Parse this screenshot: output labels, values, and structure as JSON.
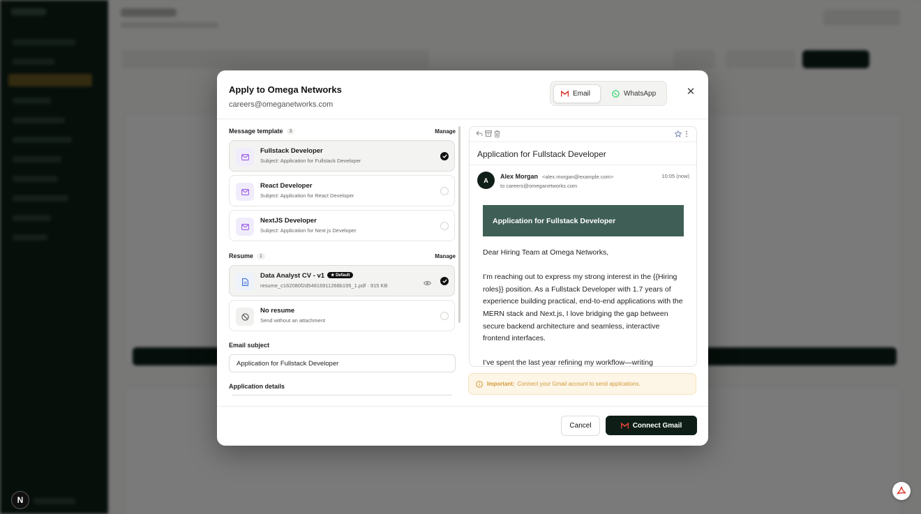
{
  "colors": {
    "accent_dark": "#0e1e17",
    "banner_green": "#3f5e56",
    "notice_text": "#d19a3a",
    "gmail_red": "#d93025",
    "whatsapp_green": "#25d366"
  },
  "modal": {
    "title": "Apply to Omega Networks",
    "subtitle": "careers@omeganetworks.com",
    "channels": {
      "email": "Email",
      "whatsapp": "WhatsApp",
      "selected": "Email"
    },
    "close_icon": "close-icon"
  },
  "templates": {
    "label": "Message template",
    "count": "3",
    "manage": "Manage",
    "items": [
      {
        "title": "Fullstack Developer",
        "subject": "Subject: Application for Fullstack Developer",
        "selected": true
      },
      {
        "title": "React Developer",
        "subject": "Subject: Application for React Developer",
        "selected": false
      },
      {
        "title": "NextJS Developer",
        "subject": "Subject: Application for Next js Developer",
        "selected": false
      }
    ]
  },
  "resume": {
    "label": "Resume",
    "count": "1",
    "manage": "Manage",
    "items": [
      {
        "title": "Data Analyst CV - v1",
        "badge": "Default",
        "file": "resume_c162080f2d54816911268b195_1.pdf · 915 KB",
        "selected": true
      },
      {
        "title": "No resume",
        "file": "Send without an attachment",
        "selected": false
      }
    ]
  },
  "email_subject": {
    "label": "Email subject",
    "value": "Application for Fullstack Developer"
  },
  "application_details": {
    "label": "Application details"
  },
  "preview": {
    "subject": "Application for Fullstack Developer",
    "avatar_initial": "A",
    "from_name": "Alex Morgan",
    "from_email": "<alex.morgan@example.com>",
    "to": "to careers@omeganetworks.com",
    "time": "10:05 (now)",
    "banner": "Application for Fullstack Developer",
    "paragraphs": [
      "Dear Hiring Team at Omega Networks,",
      "I’m reaching out to express my strong interest in the {{Hiring roles}} position. As a Fullstack Developer with 1.7 years of experience building practical, end-to-end applications with the MERN stack and Next.js, I love bridging the gap between secure backend architecture and seamless, interactive frontend interfaces.",
      "I’ve spent the last year refining my workflow—writing"
    ]
  },
  "notice": {
    "strong": "Important:",
    "text": "Connect your Gmail account to send applications."
  },
  "footer": {
    "cancel": "Cancel",
    "connect": "Connect Gmail"
  },
  "next_badge": "N"
}
